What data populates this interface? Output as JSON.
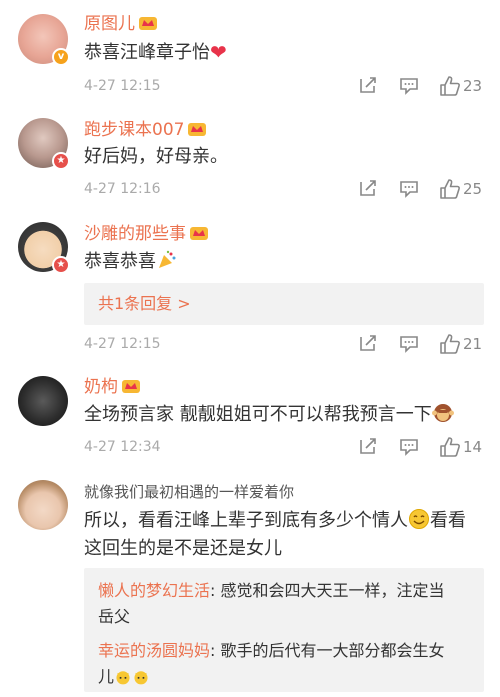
{
  "comments": [
    {
      "name": "原图儿",
      "text": "恭喜汪峰章子怡",
      "time": "4-27 12:15",
      "likes": "23"
    },
    {
      "name": "跑步课本007",
      "text": "好后妈，好母亲。",
      "time": "4-27 12:16",
      "likes": "25"
    },
    {
      "name": "沙雕的那些事",
      "text": "恭喜恭喜",
      "reply_link": "共1条回复 >",
      "time": "4-27 12:15",
      "likes": "21"
    },
    {
      "name": "奶枸",
      "text": "全场预言家  靓靓姐姐可不可以帮我预言一下",
      "time": "4-27 12:34",
      "likes": "14"
    },
    {
      "name": "就像我们最初相遇的一样爱着你",
      "text_line1": "所以，看看汪峰上辈子到底有多少个情人",
      "text_line1b": "看看",
      "text_line2": "这回生的是不是还是女儿",
      "replies": [
        {
          "name": "懒人的梦幻生活",
          "sep": ": ",
          "text1": "感觉和会四大天王一样，注定当",
          "text2": "岳父"
        },
        {
          "name": "幸运的汤圆妈妈",
          "sep": ": ",
          "text1": "歌手的后代有一大部分都会生女",
          "text2": "儿"
        }
      ]
    }
  ],
  "colors": {
    "name": "#eb7350",
    "text": "#333333",
    "meta": "#aaaaaa",
    "reply_bg": "#f2f2f2"
  },
  "icons": [
    "share-icon",
    "comment-icon",
    "like-icon",
    "crown-icon",
    "verified-badge-icon"
  ]
}
